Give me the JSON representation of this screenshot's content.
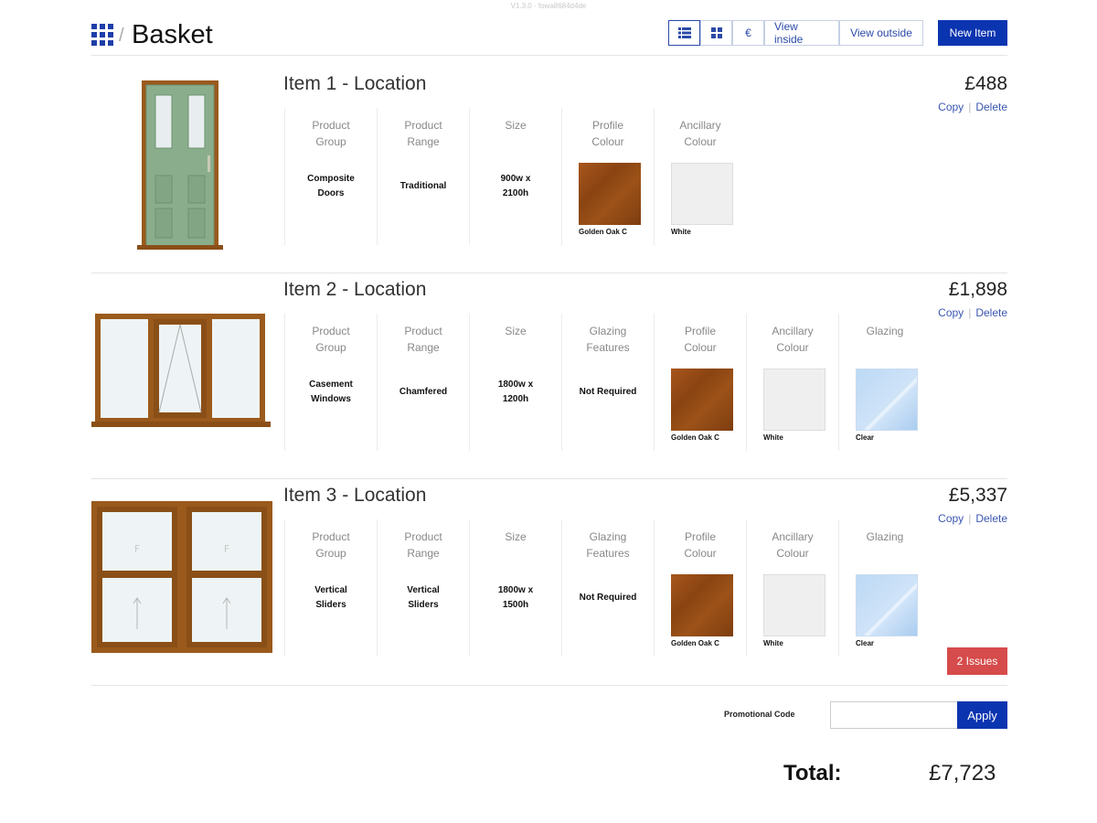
{
  "version": "V1.3.0 - fowa8684d4de",
  "header": {
    "title": "Basket",
    "separator": "/",
    "toolbar": {
      "list_view": "list-view-icon",
      "grid_view": "grid-view-icon",
      "currency": "€",
      "view_inside": "View inside",
      "view_outside": "View outside",
      "new_item": "New Item"
    }
  },
  "items": [
    {
      "title": "Item 1 - Location",
      "price": "£488",
      "copy": "Copy",
      "delete": "Delete",
      "columns": [
        {
          "head1": "Product",
          "head2": "Group",
          "value1": "Composite",
          "value2": "Doors"
        },
        {
          "head1": "Product",
          "head2": "Range",
          "value1": "Traditional",
          "value2": ""
        },
        {
          "head1": "Size",
          "head2": "",
          "value1": "900w x",
          "value2": "2100h"
        },
        {
          "head1": "Profile",
          "head2": "Colour",
          "swatch": "oak",
          "swatch_label": "Golden Oak C"
        },
        {
          "head1": "Ancillary",
          "head2": "Colour",
          "swatch": "white",
          "swatch_label": "White"
        }
      ]
    },
    {
      "title": "Item 2 - Location",
      "price": "£1,898",
      "copy": "Copy",
      "delete": "Delete",
      "columns": [
        {
          "head1": "Product",
          "head2": "Group",
          "value1": "Casement",
          "value2": "Windows"
        },
        {
          "head1": "Product",
          "head2": "Range",
          "value1": "Chamfered",
          "value2": ""
        },
        {
          "head1": "Size",
          "head2": "",
          "value1": "1800w x",
          "value2": "1200h"
        },
        {
          "head1": "Glazing",
          "head2": "Features",
          "value1": "Not Required",
          "value2": ""
        },
        {
          "head1": "Profile",
          "head2": "Colour",
          "swatch": "oak",
          "swatch_label": "Golden Oak C"
        },
        {
          "head1": "Ancillary",
          "head2": "Colour",
          "swatch": "white",
          "swatch_label": "White"
        },
        {
          "head1": "Glazing",
          "head2": "",
          "swatch": "clear",
          "swatch_label": "Clear"
        }
      ]
    },
    {
      "title": "Item 3 - Location",
      "price": "£5,337",
      "copy": "Copy",
      "delete": "Delete",
      "issues": "2 Issues",
      "columns": [
        {
          "head1": "Product",
          "head2": "Group",
          "value1": "Vertical",
          "value2": "Sliders"
        },
        {
          "head1": "Product",
          "head2": "Range",
          "value1": "Vertical",
          "value2": "Sliders"
        },
        {
          "head1": "Size",
          "head2": "",
          "value1": "1800w x",
          "value2": "1500h"
        },
        {
          "head1": "Glazing",
          "head2": "Features",
          "value1": "Not Required",
          "value2": ""
        },
        {
          "head1": "Profile",
          "head2": "Colour",
          "swatch": "oak",
          "swatch_label": "Golden Oak C"
        },
        {
          "head1": "Ancillary",
          "head2": "Colour",
          "swatch": "white",
          "swatch_label": "White"
        },
        {
          "head1": "Glazing",
          "head2": "",
          "swatch": "clear",
          "swatch_label": "Clear"
        }
      ]
    }
  ],
  "footer": {
    "promo_label": "Promotional Code",
    "promo_value": "",
    "apply": "Apply",
    "total_label": "Total:",
    "total_value": "£7,723"
  },
  "colors": {
    "accent": "#0b34b0",
    "issues": "#d64b4b",
    "frame_green": "#8aae8c",
    "frame_oak": "#9a5a1c"
  }
}
